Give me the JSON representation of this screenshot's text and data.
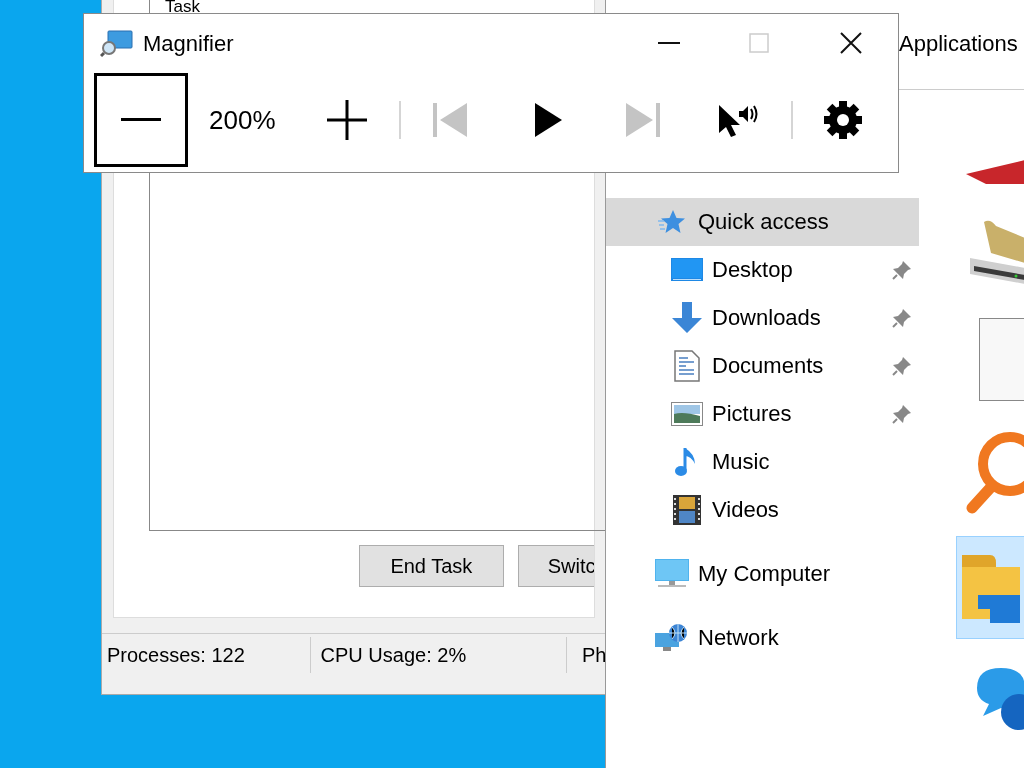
{
  "task_manager": {
    "list_header": "Task",
    "buttons": [
      "End Task",
      "Switc"
    ],
    "status_bar": [
      "Processes: 122",
      "CPU Usage: 2%",
      "Ph"
    ]
  },
  "explorer": {
    "header": "Applications",
    "nav": [
      {
        "label": "Quick access",
        "kind": "quick",
        "selected": true,
        "children": [
          {
            "label": "Desktop",
            "kind": "desktop",
            "selected": false,
            "pinned": true
          },
          {
            "label": "Downloads",
            "kind": "downloads",
            "selected": false,
            "pinned": true
          },
          {
            "label": "Documents",
            "kind": "documents",
            "selected": false,
            "pinned": true
          },
          {
            "label": "Pictures",
            "kind": "pictures",
            "selected": false,
            "pinned": true
          },
          {
            "label": "Music",
            "kind": "music",
            "selected": false,
            "pinned": false
          },
          {
            "label": "Videos",
            "kind": "videos",
            "selected": false,
            "pinned": false
          }
        ]
      },
      {
        "label": "My Computer",
        "kind": "computer",
        "selected": false
      },
      {
        "label": "Network",
        "kind": "network",
        "selected": false
      }
    ],
    "tiles": [
      {
        "kind": "red",
        "selected": false
      },
      {
        "kind": "drive",
        "selected": false
      },
      {
        "kind": "blank",
        "selected": false
      },
      {
        "kind": "search",
        "selected": false
      },
      {
        "kind": "folder",
        "selected": true
      },
      {
        "kind": "help",
        "selected": false
      }
    ]
  },
  "magnifier": {
    "title": "Magnifier",
    "zoom_level": "200%",
    "toolbar": [
      {
        "kind": "zoom_out",
        "focused": true,
        "disabled": false
      },
      {
        "kind": "zoom_in",
        "focused": false,
        "disabled": false
      },
      {
        "kind": "previous",
        "focused": false,
        "disabled": true
      },
      {
        "kind": "play",
        "focused": false,
        "disabled": false
      },
      {
        "kind": "next",
        "focused": false,
        "disabled": true
      },
      {
        "kind": "pointer",
        "focused": false,
        "disabled": false
      },
      {
        "kind": "settings",
        "focused": false,
        "disabled": false
      }
    ]
  }
}
